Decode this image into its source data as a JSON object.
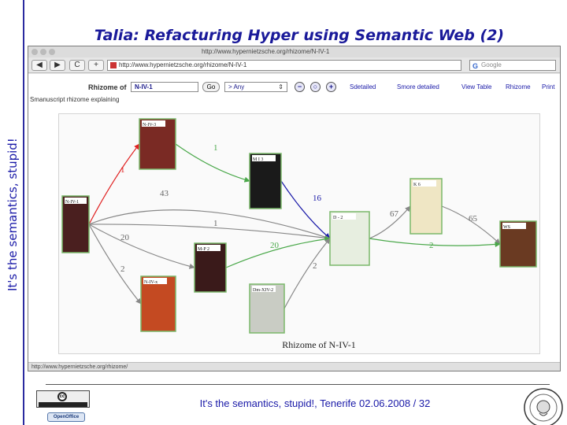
{
  "slide": {
    "title": "Talia: Refacturing Hyper using Semantic Web (2)",
    "side_label": "It's the semantics, stupid!",
    "footer": "It's the semantics, stupid!, Tenerife 02.06.2008 / 32"
  },
  "browser": {
    "window_title": "http://www.hypernietzsche.org/rhizome/N-IV-1",
    "back_label": "◀",
    "forward_label": "▶",
    "reload_label": "C",
    "new_tab_label": "+",
    "address": "http://www.hypernietzsche.org/rhizome/N-IV-1",
    "search_placeholder": "Google",
    "status_text": "http://www.hypernietzsche.org/rhizome/"
  },
  "toolbar": {
    "rhizome_label": "Rhizome of",
    "rhizome_value": "N-IV-1",
    "go_label": "Go",
    "filter_value": "> Any",
    "links": [
      "Sdetailed",
      "Smore detailed",
      "View Table",
      "Rhizome",
      "Print"
    ]
  },
  "caption_line": "Smanuscript rhizome explaining",
  "graph": {
    "caption": "Rhizome of N-IV-1",
    "nodes": [
      {
        "id": "NIV1",
        "label": "N-IV-1",
        "color": "#4a1f1f"
      },
      {
        "id": "NIV3",
        "label": "N-IV-3",
        "color": "#7a2a24"
      },
      {
        "id": "MI3",
        "label": "M I 3",
        "color": "#1a1a1a"
      },
      {
        "id": "MP2",
        "label": "M-P 2",
        "color": "#3a1a1a"
      },
      {
        "id": "NIVx",
        "label": "N-IV-x",
        "color": "#c44a22"
      },
      {
        "id": "DMXIV2",
        "label": "Dm-XIV-2",
        "color": "#c9ccc4"
      },
      {
        "id": "D2",
        "label": "D - 2",
        "color": "#e7eee0"
      },
      {
        "id": "K6",
        "label": "K 6",
        "color": "#efe6c4"
      },
      {
        "id": "WS",
        "label": "WS",
        "color": "#6a3a22"
      }
    ],
    "edges": [
      {
        "from": "NIV1",
        "to": "NIV3",
        "label": "1",
        "color": "#e02222"
      },
      {
        "from": "NIV3",
        "to": "MI3",
        "label": "1",
        "color": "#4aa84a"
      },
      {
        "from": "NIV1",
        "to": "D2",
        "label": "43",
        "color": "#888888"
      },
      {
        "from": "MI3",
        "to": "D2",
        "label": "16",
        "color": "#1a1aa8"
      },
      {
        "from": "NIV1",
        "to": "D2",
        "label": "1",
        "color": "#888888"
      },
      {
        "from": "NIV1",
        "to": "MP2",
        "label": "20",
        "color": "#888888"
      },
      {
        "from": "MP2",
        "to": "D2",
        "label": "20",
        "color": "#4aa84a"
      },
      {
        "from": "NIV1",
        "to": "NIVx",
        "label": "2",
        "color": "#888888"
      },
      {
        "from": "DMXIV2",
        "to": "D2",
        "label": "2",
        "color": "#888888"
      },
      {
        "from": "D2",
        "to": "K6",
        "label": "67",
        "color": "#888888"
      },
      {
        "from": "K6",
        "to": "WS",
        "label": "65",
        "color": "#888888"
      },
      {
        "from": "D2",
        "to": "WS",
        "label": "2",
        "color": "#4aa84a"
      }
    ]
  }
}
